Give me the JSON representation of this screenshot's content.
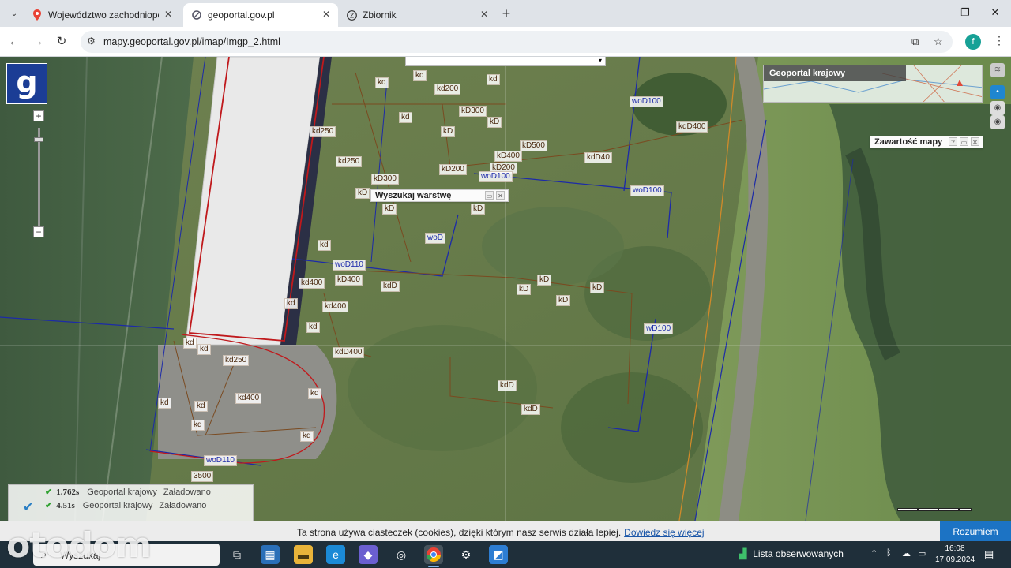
{
  "browser": {
    "tabs": [
      {
        "title": "Województwo zachodniopomorskie",
        "favicon": "map-pin-icon",
        "active": false
      },
      {
        "title": "geoportal.gov.pl",
        "favicon": "geoportal-icon",
        "active": true
      },
      {
        "title": "Zbiornik",
        "favicon": "z-icon",
        "active": false
      }
    ],
    "url": "mapy.geoportal.gov.pl/imap/Imgp_2.html",
    "profile_initial": "f"
  },
  "map": {
    "logo_letter": "g",
    "overview_title": "Geoportal krajowy",
    "panels": {
      "search_layer": "Wyszukaj warstwę",
      "map_content": "Zawartość mapy"
    },
    "labels": [
      {
        "text": "kd",
        "cls": "brown"
      },
      {
        "text": "kd",
        "cls": "brown"
      },
      {
        "text": "kd200",
        "cls": "brown"
      },
      {
        "text": "kd",
        "cls": "brown"
      },
      {
        "text": "kd",
        "cls": "brown"
      },
      {
        "text": "kD",
        "cls": "brown"
      },
      {
        "text": "kD300",
        "cls": "brown"
      },
      {
        "text": "kD",
        "cls": "brown"
      },
      {
        "text": "kD500",
        "cls": "brown"
      },
      {
        "text": "kD400",
        "cls": "brown"
      },
      {
        "text": "kdD40",
        "cls": "brown"
      },
      {
        "text": "kD200",
        "cls": "brown"
      },
      {
        "text": "kD200",
        "cls": "brown"
      },
      {
        "text": "woD100",
        "cls": "blue"
      },
      {
        "text": "woD100",
        "cls": "blue"
      },
      {
        "text": "woD100",
        "cls": "blue"
      },
      {
        "text": "kdD400",
        "cls": "brown"
      },
      {
        "text": "kd250",
        "cls": "brown"
      },
      {
        "text": "kd250",
        "cls": "brown"
      },
      {
        "text": "kD300",
        "cls": "brown"
      },
      {
        "text": "kD",
        "cls": "brown"
      },
      {
        "text": "kD",
        "cls": "brown"
      },
      {
        "text": "kD",
        "cls": "brown"
      },
      {
        "text": "woD",
        "cls": "blue"
      },
      {
        "text": "kd",
        "cls": "brown"
      },
      {
        "text": "woD110",
        "cls": "blue"
      },
      {
        "text": "kD400",
        "cls": "brown"
      },
      {
        "text": "kdD",
        "cls": "brown"
      },
      {
        "text": "kD",
        "cls": "brown"
      },
      {
        "text": "kD",
        "cls": "brown"
      },
      {
        "text": "kD",
        "cls": "brown"
      },
      {
        "text": "kD",
        "cls": "brown"
      },
      {
        "text": "kd400",
        "cls": "brown"
      },
      {
        "text": "kd400",
        "cls": "brown"
      },
      {
        "text": "kd",
        "cls": "brown"
      },
      {
        "text": "kd",
        "cls": "brown"
      },
      {
        "text": "kd",
        "cls": "brown"
      },
      {
        "text": "kd",
        "cls": "brown"
      },
      {
        "text": "wD100",
        "cls": "blue"
      },
      {
        "text": "kd250",
        "cls": "brown"
      },
      {
        "text": "kdD400",
        "cls": "brown"
      },
      {
        "text": "kdD",
        "cls": "brown"
      },
      {
        "text": "kdD",
        "cls": "brown"
      },
      {
        "text": "kd400",
        "cls": "brown"
      },
      {
        "text": "kd",
        "cls": "brown"
      },
      {
        "text": "kd",
        "cls": "brown"
      },
      {
        "text": "kd",
        "cls": "brown"
      },
      {
        "text": "kd",
        "cls": "brown"
      },
      {
        "text": "kd",
        "cls": "brown"
      },
      {
        "text": "woD110",
        "cls": "blue"
      },
      {
        "text": "3500",
        "cls": "brown"
      }
    ],
    "status_rows": [
      {
        "time": "1.762s",
        "source": "Geoportal krajowy",
        "state": "Załadowano"
      },
      {
        "time": "4.51s",
        "source": "Geoportal krajowy",
        "state": "Załadowano"
      }
    ]
  },
  "cookie": {
    "text": "Ta strona używa ciasteczek (cookies), dzięki którym nasz serwis działa lepiej.",
    "link": "Dowiedz się więcej",
    "button": "Rozumiem"
  },
  "taskbar": {
    "search_text": "Wyszukaj",
    "watchlist": "Lista obserwowanych",
    "time": "16:08",
    "date": "17.09.2024"
  },
  "watermark": "otodom"
}
